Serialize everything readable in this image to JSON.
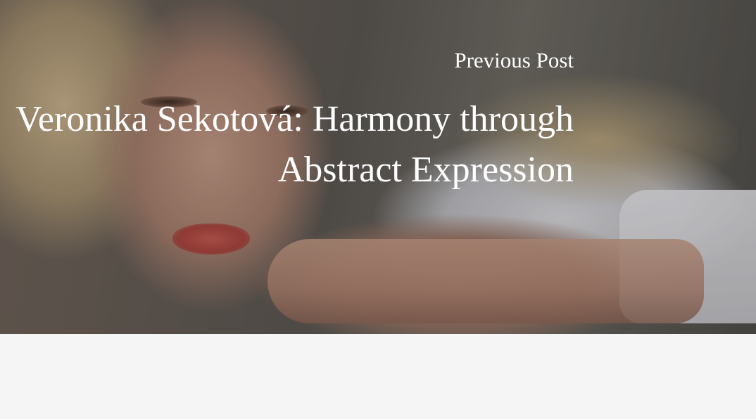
{
  "nav": {
    "label": "Previous Post",
    "title": "Veronika Sekotová: Harmony through Abstract Expression"
  },
  "colors": {
    "text": "#ffffff",
    "page_background": "#f5f5f5"
  }
}
